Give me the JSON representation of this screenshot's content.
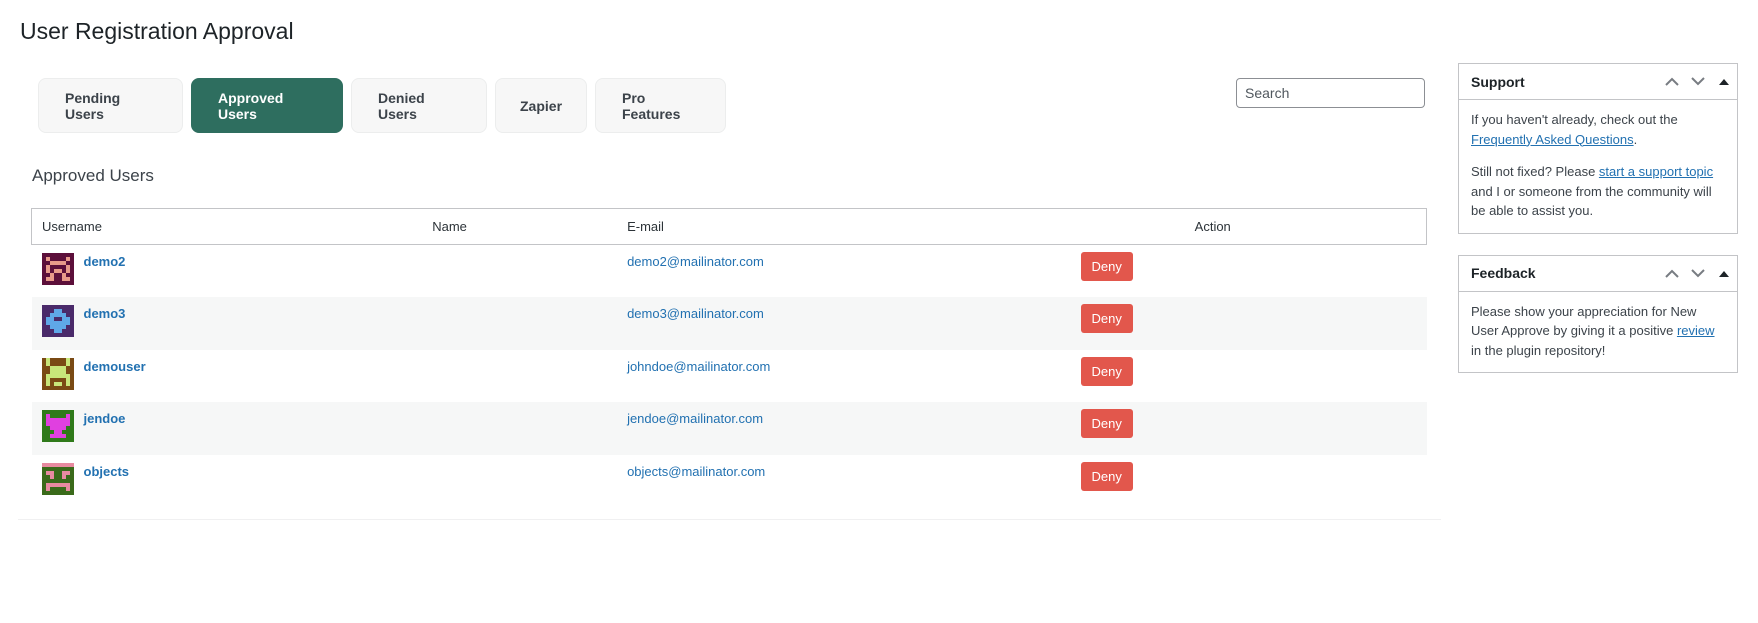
{
  "page": {
    "title": "User Registration Approval"
  },
  "tabs": [
    {
      "label": "Pending Users",
      "active": false
    },
    {
      "label": "Approved Users",
      "active": true
    },
    {
      "label": "Denied Users",
      "active": false
    },
    {
      "label": "Zapier",
      "active": false
    },
    {
      "label": "Pro Features",
      "active": false
    }
  ],
  "search": {
    "placeholder": "Search",
    "value": ""
  },
  "section": {
    "heading": "Approved Users"
  },
  "table": {
    "columns": [
      "Username",
      "Name",
      "E-mail",
      "Action"
    ],
    "rows": [
      {
        "username": "demo2",
        "name": "",
        "email": "demo2@mailinator.com",
        "action": "Deny",
        "avatar_bg": "#5c0f3a",
        "avatar_fg": "#e89a8a"
      },
      {
        "username": "demo3",
        "name": "",
        "email": "demo3@mailinator.com",
        "action": "Deny",
        "avatar_bg": "#4a2a6a",
        "avatar_fg": "#5fa8e8"
      },
      {
        "username": "demouser",
        "name": "",
        "email": "johndoe@mailinator.com",
        "action": "Deny",
        "avatar_bg": "#7a4a14",
        "avatar_fg": "#c8e67a"
      },
      {
        "username": "jendoe",
        "name": "",
        "email": "jendoe@mailinator.com",
        "action": "Deny",
        "avatar_bg": "#2f7a1a",
        "avatar_fg": "#e040e0"
      },
      {
        "username": "objects",
        "name": "",
        "email": "objects@mailinator.com",
        "action": "Deny",
        "avatar_bg": "#3a6a1a",
        "avatar_fg": "#e88aa0"
      }
    ]
  },
  "sidebar": {
    "support": {
      "title": "Support",
      "text1_pre": "If you haven't already, check out the ",
      "text1_link": "Frequently Asked Questions",
      "text1_post": ".",
      "text2_pre": "Still not fixed? Please ",
      "text2_link": "start a support topic",
      "text2_post": " and I or someone from the community will be able to assist you."
    },
    "feedback": {
      "title": "Feedback",
      "text_pre": "Please show your appreciation for New User Approve by giving it a positive ",
      "text_link": "review",
      "text_post": " in the plugin repository!"
    }
  },
  "colors": {
    "active_tab": "#2e6e5f",
    "deny_button": "#e2574c",
    "link": "#2271b1"
  },
  "icons": [
    "chevron-up-icon",
    "chevron-down-icon",
    "toggle-arrow-icon"
  ]
}
